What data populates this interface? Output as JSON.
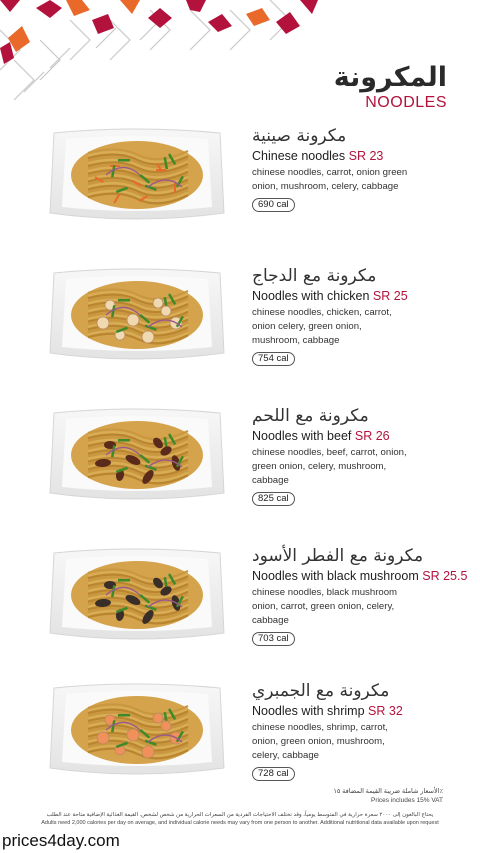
{
  "header": {
    "title_ar": "المكرونة",
    "title_en": "NOODLES"
  },
  "colors": {
    "accent": "#b3123c",
    "pattern_orange": "#e8692a",
    "pattern_red": "#b3123c"
  },
  "items": [
    {
      "name_ar": "مكرونة صينية",
      "name_en": "Chinese noodles",
      "price": "SR 23",
      "desc": "chinese noodles, carrot, onion green onion, mushroom, celery, cabbage",
      "cal": "690 cal"
    },
    {
      "name_ar": "مكرونة مع الدجاج",
      "name_en": "Noodles with chicken",
      "price": "SR 25",
      "desc": "chinese noodles, chicken, carrot, onion celery, green onion, mushroom, cabbage",
      "cal": "754 cal"
    },
    {
      "name_ar": "مكرونة مع اللحم",
      "name_en": "Noodles with beef",
      "price": "SR 26",
      "desc": "chinese noodles, beef, carrot, onion, green onion, celery, mushroom, cabbage",
      "cal": "825 cal"
    },
    {
      "name_ar": "مكرونة مع الفطر الأسود",
      "name_en": "Noodles with black mushroom",
      "price": "SR 25.5",
      "desc": "chinese noodles, black mushroom onion, carrot, green onion, celery, cabbage",
      "cal": "703 cal"
    },
    {
      "name_ar": "مكرونة مع الجمبري",
      "name_en": "Noodles with shrimp",
      "price": "SR 32",
      "desc": "chinese noodles, shrimp, carrot, onion, green onion, mushroom, celery, cabbage",
      "cal": "728 cal"
    }
  ],
  "vat": {
    "ar": "الأسعار شاملة ضريبة القيمة المضافة ١٥٪",
    "en": "Prices includes 15% VAT"
  },
  "footnote": {
    "ar": "يحتاج البالغون إلى ٢٠٠٠ سعرة حرارية في المتوسط يومياً، وقد تختلف الاحتياجات الفردية من السعرات الحرارية من شخص لشخص. القيمة الغذائية الإضافية متاحة عند الطلب",
    "en": "Adults need 2,000 calories per day on average, and individual calorie needs may vary from one person to another. Additional nutritional data available upon request"
  },
  "watermark": "prices4day.com"
}
